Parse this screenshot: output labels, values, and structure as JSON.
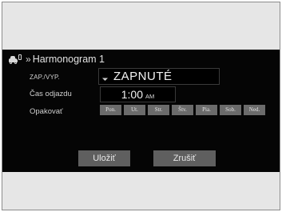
{
  "header": {
    "icon": "ev-charging-car-icon",
    "chevron": "»",
    "title": "Harmonogram 1"
  },
  "fields": {
    "status_label": "ZAP./VYP.",
    "status_value": "ZAPNUTÉ",
    "departure_label": "Čas odjazdu",
    "departure_time": "1:00",
    "departure_ampm": "AM",
    "repeat_label": "Opakovať"
  },
  "days": [
    "Pon.",
    "Ut.",
    "Str.",
    "Štv.",
    "Pia.",
    "Sob.",
    "Ned."
  ],
  "buttons": {
    "save": "Uložiť",
    "cancel": "Zrušiť"
  },
  "colors": {
    "screen_bg": "#050505",
    "frame_bg": "#e6e6e6",
    "button_bg": "#5f5f5f",
    "day_bg": "#6b6b6b"
  }
}
